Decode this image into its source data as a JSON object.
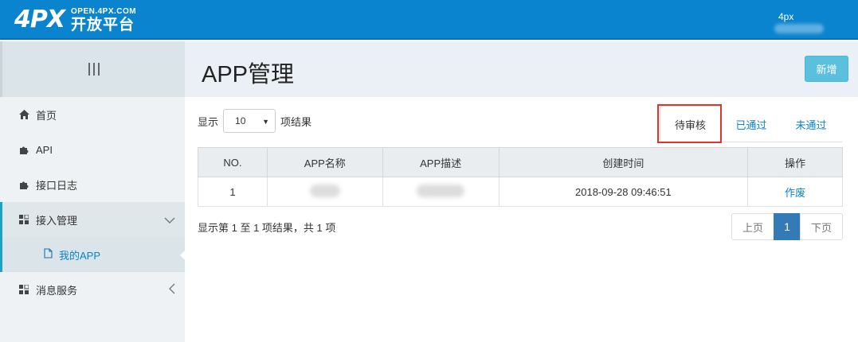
{
  "header": {
    "logo_mark": "4PX",
    "logo_domain": "OPEN.4PX.COM",
    "logo_name": "开放平台",
    "user_label": "4px"
  },
  "sidebar": {
    "items": [
      {
        "label": "首页",
        "icon": "home-icon"
      },
      {
        "label": "API",
        "icon": "puzzle-icon"
      },
      {
        "label": "接口日志",
        "icon": "puzzle-icon"
      },
      {
        "label": "接入管理",
        "icon": "grid-icon",
        "expanded": true
      },
      {
        "label": "消息服务",
        "icon": "grid-icon"
      }
    ],
    "sub_item": {
      "label": "我的APP",
      "icon": "file-icon"
    }
  },
  "page": {
    "title": "APP管理",
    "new_button": "新增"
  },
  "length": {
    "prefix": "显示",
    "value": "10",
    "suffix": "项结果"
  },
  "tabs": [
    {
      "label": "待审核",
      "active": true
    },
    {
      "label": "已通过"
    },
    {
      "label": "未通过"
    }
  ],
  "table": {
    "headers": [
      "NO.",
      "APP名称",
      "APP描述",
      "创建时间",
      "操作"
    ],
    "rows": [
      {
        "no": "1",
        "created": "2018-09-28 09:46:51",
        "action": "作废"
      }
    ]
  },
  "info": "显示第 1 至 1 项结果，共 1 项",
  "pagination": {
    "prev": "上页",
    "current": "1",
    "next": "下页"
  },
  "colors": {
    "topbar": "#0a84cf",
    "accent": "#5bc0de",
    "active_page": "#337ab7",
    "highlight": "#e0332f"
  }
}
